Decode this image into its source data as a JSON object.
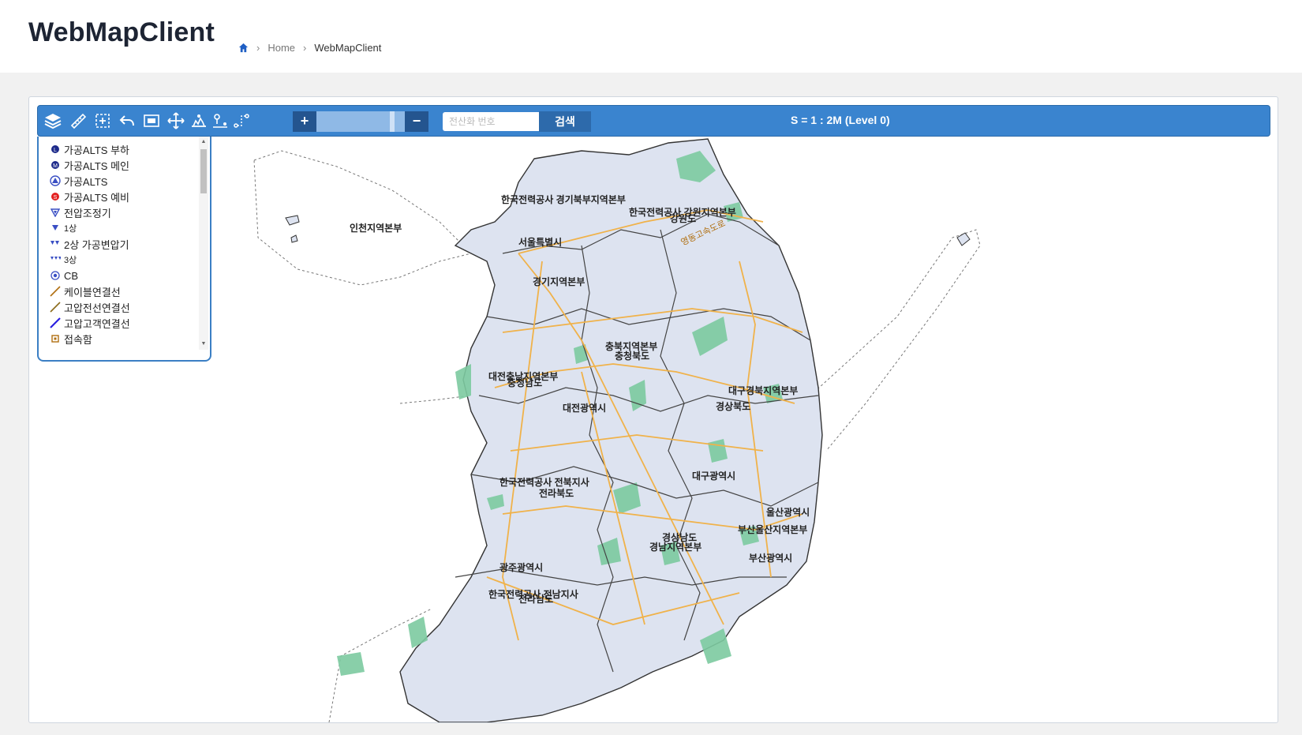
{
  "header": {
    "title": "WebMapClient",
    "breadcrumb": {
      "home_icon": "home-icon",
      "items": [
        "Home",
        "WebMapClient"
      ]
    }
  },
  "toolbar": {
    "icons": [
      "layers-icon",
      "measure-icon",
      "zoom-box-icon",
      "undo-icon",
      "full-extent-icon",
      "pan-icon",
      "overview-icon",
      "route-icon",
      "path-icon"
    ],
    "zoom_in_label": "+",
    "zoom_out_label": "−",
    "zoom_level_fraction": 0.88,
    "search_placeholder": "전산화 번호",
    "search_value": "",
    "search_button_label": "검색",
    "scale_text": "S = 1 : 2M (Level 0)",
    "background_color": "#3a84cf"
  },
  "legend": {
    "items": [
      {
        "label": "가공ALTS 부하",
        "icon": "alts-load-icon"
      },
      {
        "label": "가공ALTS 메인",
        "icon": "alts-main-icon"
      },
      {
        "label": "가공ALTS",
        "icon": "alts-icon"
      },
      {
        "label": "가공ALTS 예비",
        "icon": "alts-spare-icon"
      },
      {
        "label": "전압조정기",
        "icon": "voltage-regulator-icon"
      },
      {
        "label": "1상",
        "icon": "single-phase-icon"
      },
      {
        "label": "2상 가공변압기",
        "icon": "two-phase-transformer-icon"
      },
      {
        "label": "3상",
        "icon": "three-phase-icon"
      },
      {
        "label": "CB",
        "icon": "circuit-breaker-icon"
      },
      {
        "label": "케이블연결선",
        "icon": "cable-line-icon"
      },
      {
        "label": "고압전선연결선",
        "icon": "hv-wire-line-icon"
      },
      {
        "label": "고압고객연결선",
        "icon": "hv-customer-line-icon"
      },
      {
        "label": "접속함",
        "icon": "junction-box-icon"
      }
    ]
  },
  "map": {
    "labels": [
      "한국전력공사 경기북부지역본부",
      "한국전력공사 강원지역본부",
      "강원도",
      "인천지역본부",
      "서울특별시",
      "경기지역본부",
      "충북지역본부",
      "충청북도",
      "대전충남지역본부",
      "충청남도",
      "대전광역시",
      "대구경북지역본부",
      "경상북도",
      "대구광역시",
      "한국전력공사 전북지사",
      "전라북도",
      "울산광역시",
      "부산울산지역본부",
      "경상남도",
      "경남지역본부",
      "부산광역시",
      "광주광역시",
      "한국전력공사 전남지사",
      "전라남도",
      "영동고속도로"
    ],
    "colors": {
      "land": "#dde3f0",
      "border": "#444444",
      "road": "#f0b24a",
      "forest": "#7ccaa0"
    }
  }
}
